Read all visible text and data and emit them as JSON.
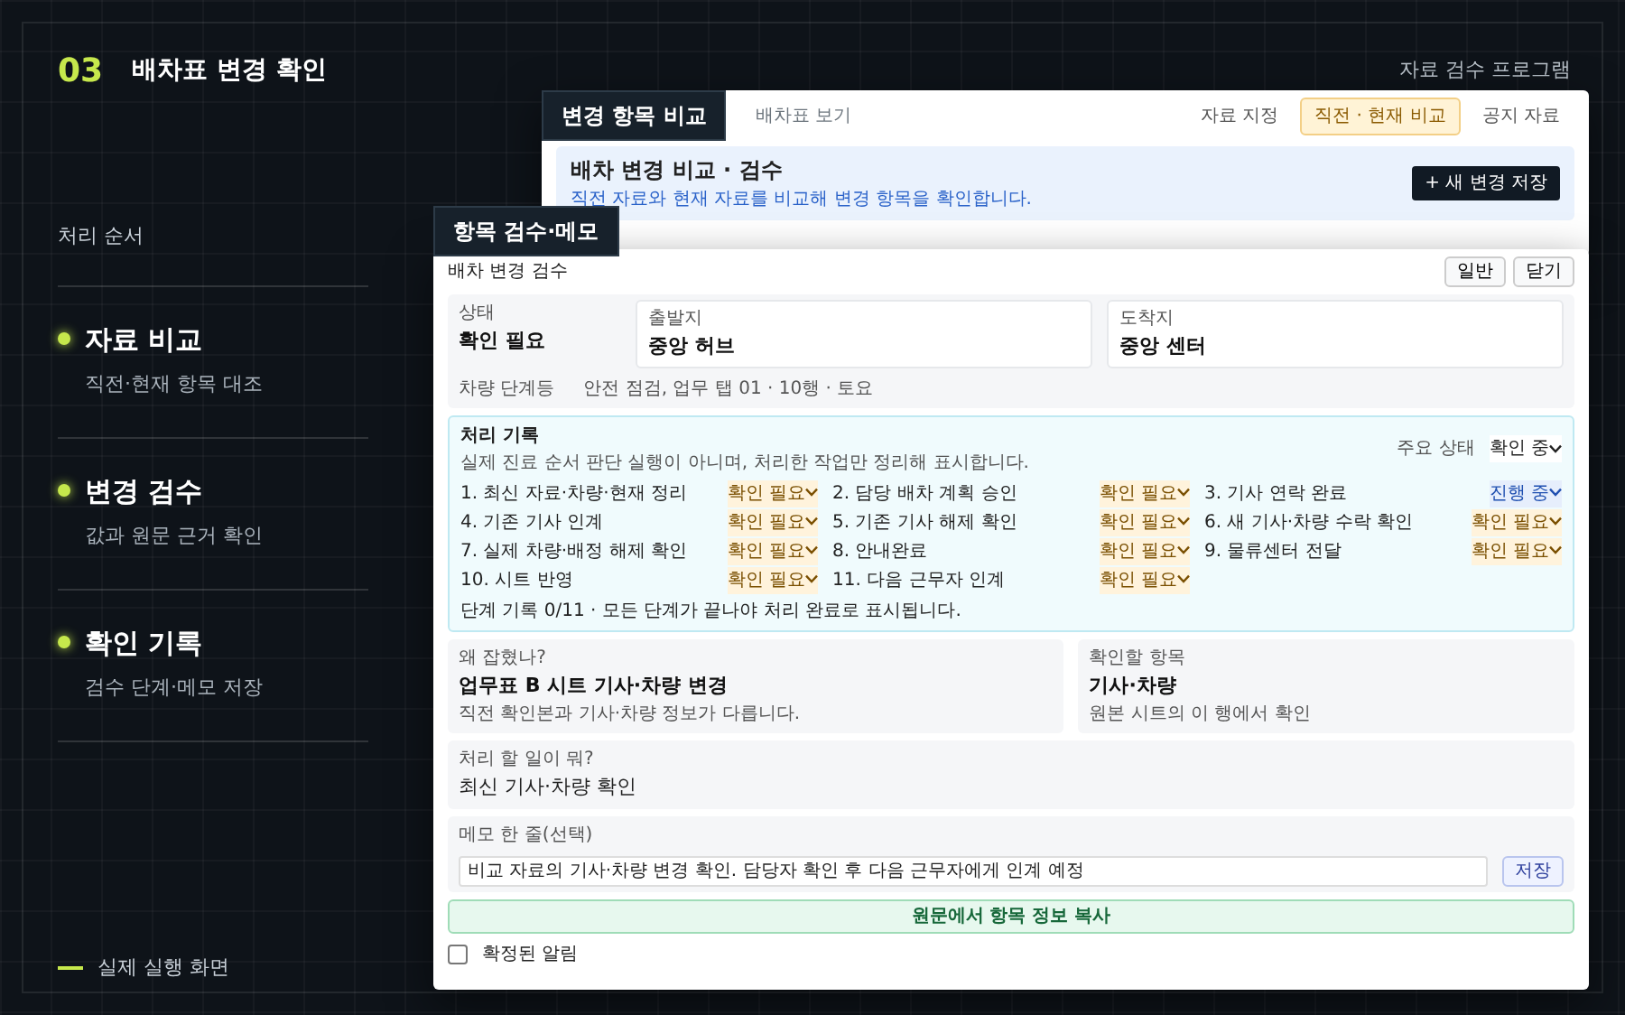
{
  "header": {
    "number": "03",
    "title": "배차표 변경 확인",
    "product": "자료 검수 프로그램"
  },
  "steps_heading": "처리 순서",
  "steps": [
    {
      "title": "자료 비교",
      "subtitle": "직전·현재 항목 대조"
    },
    {
      "title": "변경 검수",
      "subtitle": "값과 원문 근거 확인"
    },
    {
      "title": "확인 기록",
      "subtitle": "검수 단계·메모 저장"
    }
  ],
  "footer_caption": "실제 실행 화면",
  "compare_window": {
    "label": "변경 항목 비교",
    "breadcrumb": "배차표 보기",
    "tabs": [
      {
        "label": "자료 지정",
        "selected": false
      },
      {
        "label": "직전 · 현재 비교",
        "selected": true
      },
      {
        "label": "공지 자료",
        "selected": false
      }
    ],
    "title": "배차 변경 비교 · 검수",
    "subtitle": "직전 자료와 현재 자료를 비교해 변경 항목을 확인합니다.",
    "save_button": "+ 새 변경 저장"
  },
  "review_window": {
    "label": "항목 검수·메모",
    "title": "배차 변경 검수",
    "buttons": [
      "일반",
      "닫기"
    ],
    "status": {
      "label": "상태",
      "value": "확인 필요"
    },
    "origin": {
      "label": "출발지",
      "value": "중앙 허브"
    },
    "destination": {
      "label": "도착지",
      "value": "중앙 센터"
    },
    "vehicle": {
      "label": "차량 단계등",
      "value": "안전 점검, 업무 탭 01 · 10행 · 토요"
    },
    "log": {
      "title": "처리 기록",
      "description": "실제 진료 순서 판단 실행이 아니며, 처리한 작업만 정리해 표시합니다.",
      "state_label": "주요 상태",
      "state_value": "확인 중",
      "tasks": [
        {
          "label": "1. 최신 자료·차량·현재 정리",
          "status": "확인 필요",
          "kind": "pending"
        },
        {
          "label": "2. 담당 배차 계획 승인",
          "status": "확인 필요",
          "kind": "pending"
        },
        {
          "label": "3. 기사 연락 완료",
          "status": "진행 중",
          "kind": "progress"
        },
        {
          "label": "4. 기존 기사 인계",
          "status": "확인 필요",
          "kind": "pending"
        },
        {
          "label": "5. 기존 기사 해제 확인",
          "status": "확인 필요",
          "kind": "pending"
        },
        {
          "label": "6. 새 기사·차량 수락 확인",
          "status": "확인 필요",
          "kind": "pending"
        },
        {
          "label": "7. 실제 차량·배정 해제 확인",
          "status": "확인 필요",
          "kind": "pending"
        },
        {
          "label": "8. 안내완료",
          "status": "확인 필요",
          "kind": "pending"
        },
        {
          "label": "9. 물류센터 전달",
          "status": "확인 필요",
          "kind": "pending"
        },
        {
          "label": "10. 시트 반영",
          "status": "확인 필요",
          "kind": "pending"
        },
        {
          "label": "11. 다음 근무자 인계",
          "status": "확인 필요",
          "kind": "pending"
        }
      ],
      "summary": "단계 기록 0/11 · 모든 단계가 끝나야 처리 완료로 표시됩니다."
    },
    "reason": {
      "label": "왜 잡혔나?",
      "title": "업무표 B 시트 기사·차량 변경",
      "note": "직전 확인본과 기사·차량 정보가 다릅니다."
    },
    "target": {
      "label": "확인할 항목",
      "title": "기사·차량",
      "note": "원본 시트의 이 행에서 확인"
    },
    "todo": {
      "label": "처리 할 일이 뭐?",
      "value": "최신 기사·차량 확인"
    },
    "memo": {
      "label": "메모 한 줄(선택)",
      "value": "비교 자료의 기사·차량 변경 확인. 담당자 확인 후 다음 근무자에게 인계 예정",
      "button": "저장"
    },
    "copy_button": "원문에서 항목 정보 복사",
    "alert": {
      "label": "확정된 알림",
      "checked": false
    }
  }
}
